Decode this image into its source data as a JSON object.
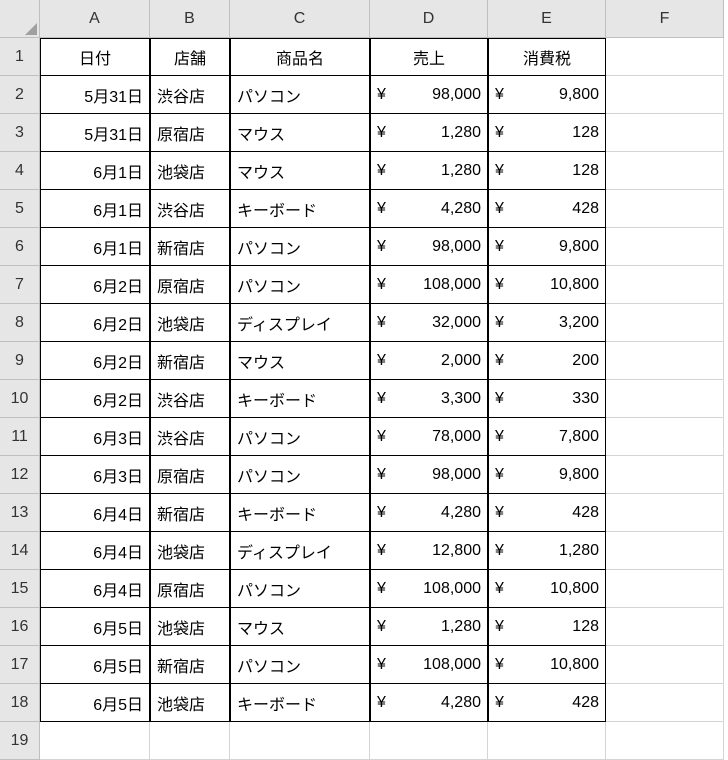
{
  "columns": [
    "A",
    "B",
    "C",
    "D",
    "E",
    "F"
  ],
  "rowCount": 19,
  "headers": {
    "date": "日付",
    "store": "店舗",
    "product": "商品名",
    "sales": "売上",
    "tax": "消費税"
  },
  "rows": [
    {
      "date": "5月31日",
      "store": "渋谷店",
      "product": "パソコン",
      "sales": "98,000",
      "tax": "9,800"
    },
    {
      "date": "5月31日",
      "store": "原宿店",
      "product": "マウス",
      "sales": "1,280",
      "tax": "128"
    },
    {
      "date": "6月1日",
      "store": "池袋店",
      "product": "マウス",
      "sales": "1,280",
      "tax": "128"
    },
    {
      "date": "6月1日",
      "store": "渋谷店",
      "product": "キーボード",
      "sales": "4,280",
      "tax": "428"
    },
    {
      "date": "6月1日",
      "store": "新宿店",
      "product": "パソコン",
      "sales": "98,000",
      "tax": "9,800"
    },
    {
      "date": "6月2日",
      "store": "原宿店",
      "product": "パソコン",
      "sales": "108,000",
      "tax": "10,800"
    },
    {
      "date": "6月2日",
      "store": "池袋店",
      "product": "ディスプレイ",
      "sales": "32,000",
      "tax": "3,200"
    },
    {
      "date": "6月2日",
      "store": "新宿店",
      "product": "マウス",
      "sales": "2,000",
      "tax": "200"
    },
    {
      "date": "6月2日",
      "store": "渋谷店",
      "product": "キーボード",
      "sales": "3,300",
      "tax": "330"
    },
    {
      "date": "6月3日",
      "store": "渋谷店",
      "product": "パソコン",
      "sales": "78,000",
      "tax": "7,800"
    },
    {
      "date": "6月3日",
      "store": "原宿店",
      "product": "パソコン",
      "sales": "98,000",
      "tax": "9,800"
    },
    {
      "date": "6月4日",
      "store": "新宿店",
      "product": "キーボード",
      "sales": "4,280",
      "tax": "428"
    },
    {
      "date": "6月4日",
      "store": "池袋店",
      "product": "ディスプレイ",
      "sales": "12,800",
      "tax": "1,280"
    },
    {
      "date": "6月4日",
      "store": "原宿店",
      "product": "パソコン",
      "sales": "108,000",
      "tax": "10,800"
    },
    {
      "date": "6月5日",
      "store": "池袋店",
      "product": "マウス",
      "sales": "1,280",
      "tax": "128"
    },
    {
      "date": "6月5日",
      "store": "新宿店",
      "product": "パソコン",
      "sales": "108,000",
      "tax": "10,800"
    },
    {
      "date": "6月5日",
      "store": "池袋店",
      "product": "キーボード",
      "sales": "4,280",
      "tax": "428"
    }
  ],
  "currency_symbol": "¥"
}
